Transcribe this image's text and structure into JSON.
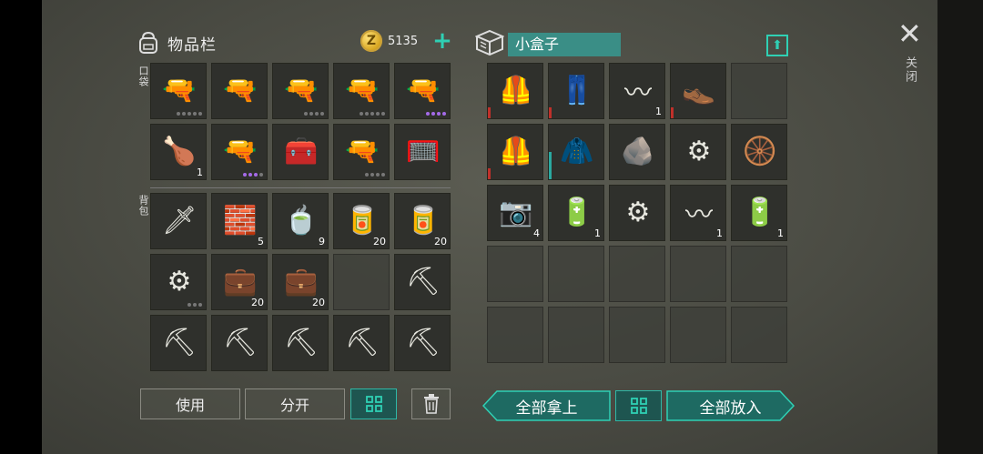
{
  "inventory": {
    "title": "物品栏",
    "coins": "5135",
    "coin_symbol": "Z",
    "plus": "+",
    "pocket_label": "口袋",
    "backpack_label": "背包",
    "pocket": [
      {
        "name": "rifle-icon",
        "glyph": "🔫",
        "qty": "",
        "dots": 5,
        "purple": 0
      },
      {
        "name": "grenade-launcher-icon",
        "glyph": "🔫",
        "qty": "",
        "dots": 0,
        "purple": 0
      },
      {
        "name": "shotgun-icon",
        "glyph": "🔫",
        "qty": "",
        "dots": 4,
        "purple": 0
      },
      {
        "name": "pump-shotgun-icon",
        "glyph": "🔫",
        "qty": "",
        "dots": 5,
        "purple": 0
      },
      {
        "name": "ak-rifle-icon",
        "glyph": "🔫",
        "qty": "",
        "dots": 4,
        "purple": 4
      },
      {
        "name": "roast-chicken-icon",
        "glyph": "🍗",
        "qty": "1",
        "dots": 0,
        "purple": 0
      },
      {
        "name": "pistol-icon",
        "glyph": "🔫",
        "qty": "",
        "dots": 4,
        "purple": 3
      },
      {
        "name": "medkit-bag-icon",
        "glyph": "🧰",
        "qty": "",
        "dots": 0,
        "purple": 0
      },
      {
        "name": "assault-rifle-icon",
        "glyph": "🔫",
        "qty": "",
        "dots": 4,
        "purple": 0
      },
      {
        "name": "fishing-net-icon",
        "glyph": "🥅",
        "qty": "",
        "dots": 0,
        "purple": 0
      }
    ],
    "backpack": [
      {
        "name": "machete-icon",
        "glyph": "🗡",
        "qty": "",
        "dots": 0,
        "purple": 0
      },
      {
        "name": "metal-bars-icon",
        "glyph": "🧱",
        "qty": "5",
        "dots": 0,
        "purple": 0
      },
      {
        "name": "red-tea-cup-icon",
        "glyph": "🍵",
        "qty": "9",
        "dots": 0,
        "purple": 0
      },
      {
        "name": "beer-can-icon",
        "glyph": "🥫",
        "qty": "20",
        "dots": 0,
        "purple": 0
      },
      {
        "name": "beer-can-icon",
        "glyph": "🥫",
        "qty": "20",
        "dots": 0,
        "purple": 0
      },
      {
        "name": "saw-club-icon",
        "glyph": "⚙",
        "qty": "",
        "dots": 3,
        "purple": 0
      },
      {
        "name": "medical-bag-icon",
        "glyph": "💼",
        "qty": "20",
        "dots": 0,
        "purple": 0
      },
      {
        "name": "medical-bag-icon",
        "glyph": "💼",
        "qty": "20",
        "dots": 0,
        "purple": 0
      },
      {
        "name": "empty-slot",
        "glyph": "",
        "qty": "",
        "dots": 0,
        "purple": 0
      },
      {
        "name": "hatchet-icon",
        "glyph": "⛏",
        "qty": "",
        "dots": 0,
        "purple": 0
      },
      {
        "name": "hatchet-icon",
        "glyph": "⛏",
        "qty": "",
        "dots": 0,
        "purple": 0
      },
      {
        "name": "hatchet-icon",
        "glyph": "⛏",
        "qty": "",
        "dots": 0,
        "purple": 0
      },
      {
        "name": "hatchet-icon",
        "glyph": "⛏",
        "qty": "",
        "dots": 0,
        "purple": 0
      },
      {
        "name": "hatchet-icon",
        "glyph": "⛏",
        "qty": "",
        "dots": 0,
        "purple": 0
      },
      {
        "name": "hatchet-icon",
        "glyph": "⛏",
        "qty": "",
        "dots": 0,
        "purple": 0
      }
    ],
    "use_label": "使用",
    "split_label": "分开"
  },
  "box": {
    "title": "小盒子",
    "items": [
      {
        "name": "vest-armor-icon",
        "glyph": "🦺",
        "qty": "",
        "bar": "red"
      },
      {
        "name": "pants-icon",
        "glyph": "👖",
        "qty": "",
        "bar": "red"
      },
      {
        "name": "spring-icon",
        "glyph": "〰",
        "qty": "1",
        "bar": ""
      },
      {
        "name": "boots-icon",
        "glyph": "👞",
        "qty": "",
        "bar": "red"
      },
      {
        "name": "empty-slot",
        "glyph": "",
        "qty": "",
        "bar": ""
      },
      {
        "name": "vest-armor-icon",
        "glyph": "🦺",
        "qty": "",
        "bar": "red"
      },
      {
        "name": "jacket-icon",
        "glyph": "🧥",
        "qty": "",
        "bar": "teal"
      },
      {
        "name": "rubble-icon",
        "glyph": "🪨",
        "qty": "",
        "bar": ""
      },
      {
        "name": "saw-blade-icon",
        "glyph": "⚙",
        "qty": "",
        "bar": ""
      },
      {
        "name": "tire-icon",
        "glyph": "🛞",
        "qty": "",
        "bar": ""
      },
      {
        "name": "camera-icon",
        "glyph": "📷",
        "qty": "4",
        "bar": ""
      },
      {
        "name": "battery-icon",
        "glyph": "🔋",
        "qty": "1",
        "bar": ""
      },
      {
        "name": "saw-blade-icon",
        "glyph": "⚙",
        "qty": "",
        "bar": ""
      },
      {
        "name": "spring-icon",
        "glyph": "〰",
        "qty": "1",
        "bar": ""
      },
      {
        "name": "battery-icon",
        "glyph": "🔋",
        "qty": "1",
        "bar": ""
      }
    ],
    "take_all_label": "全部拿上",
    "put_all_label": "全部放入"
  },
  "close": {
    "symbol": "✕",
    "label": "关闭"
  }
}
